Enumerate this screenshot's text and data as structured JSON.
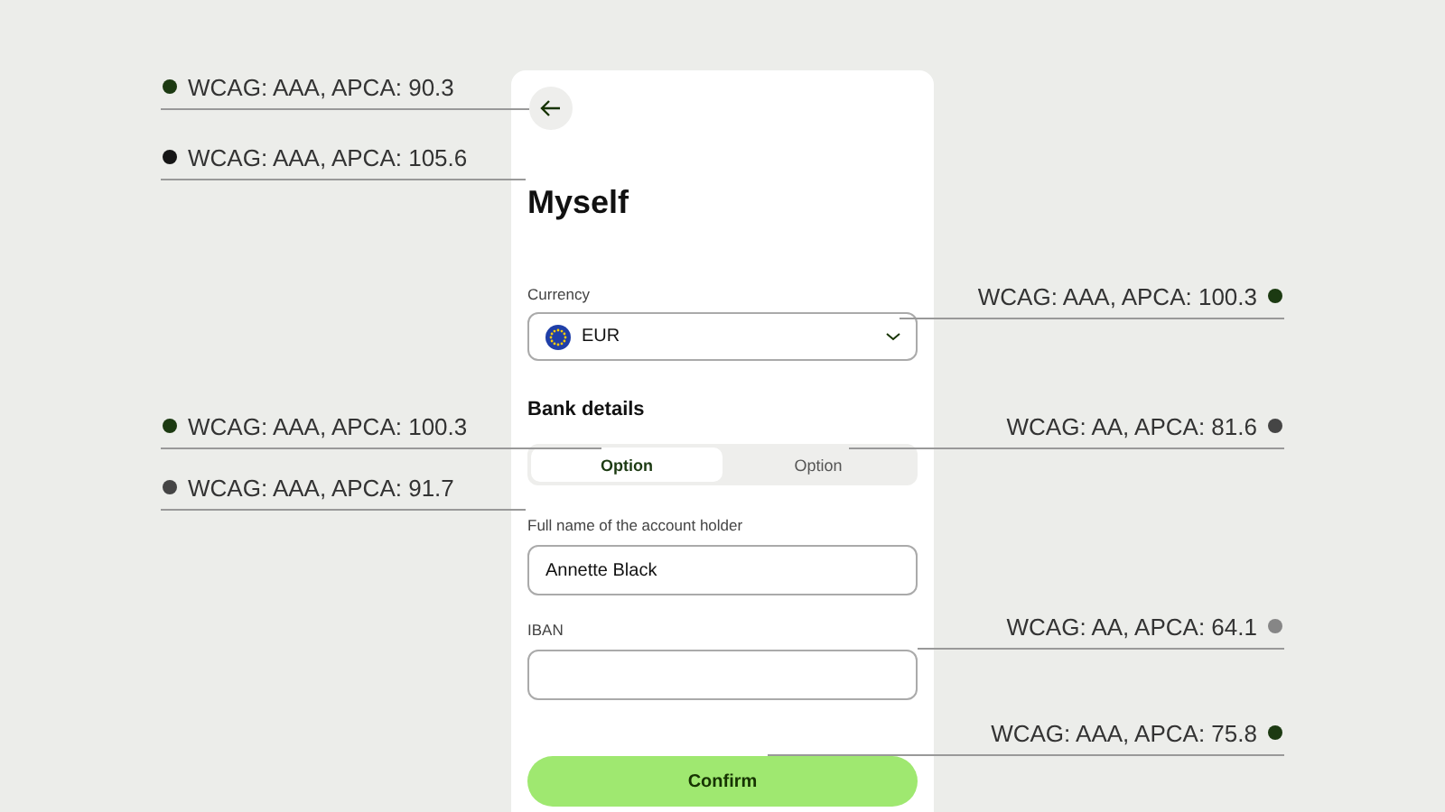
{
  "title": "Myself",
  "currency": {
    "label": "Currency",
    "value": "EUR"
  },
  "section_heading": "Bank details",
  "segments": [
    {
      "label": "Option",
      "selected": true
    },
    {
      "label": "Option",
      "selected": false
    }
  ],
  "fields": [
    {
      "label": "Full name of the account holder",
      "value": "Annette Black"
    },
    {
      "label": "IBAN"
    }
  ],
  "confirm_button": "Confirm",
  "annotations": [
    {
      "kind": "left",
      "text": "WCAG: AAA, APCA: 90.3",
      "color": "#1c3a12"
    },
    {
      "kind": "left",
      "text": "WCAG: AAA, APCA: 105.6",
      "color": "#161616"
    },
    {
      "kind": "left",
      "text": "WCAG: AAA, APCA: 100.3",
      "color": "#1c3a12"
    },
    {
      "kind": "left",
      "text": "WCAG: AAA, APCA: 91.7",
      "color": "#454545"
    },
    {
      "kind": "right",
      "text": "WCAG: AAA, APCA: 100.3",
      "color": "#1c3a12"
    },
    {
      "kind": "right",
      "text": "WCAG: AA, APCA: 81.6",
      "color": "#454545"
    },
    {
      "kind": "right",
      "text": "WCAG: AA, APCA: 64.1",
      "color": "#868686"
    },
    {
      "kind": "right",
      "text": "WCAG: AAA, APCA: 75.8",
      "color": "#1c3a12"
    }
  ]
}
